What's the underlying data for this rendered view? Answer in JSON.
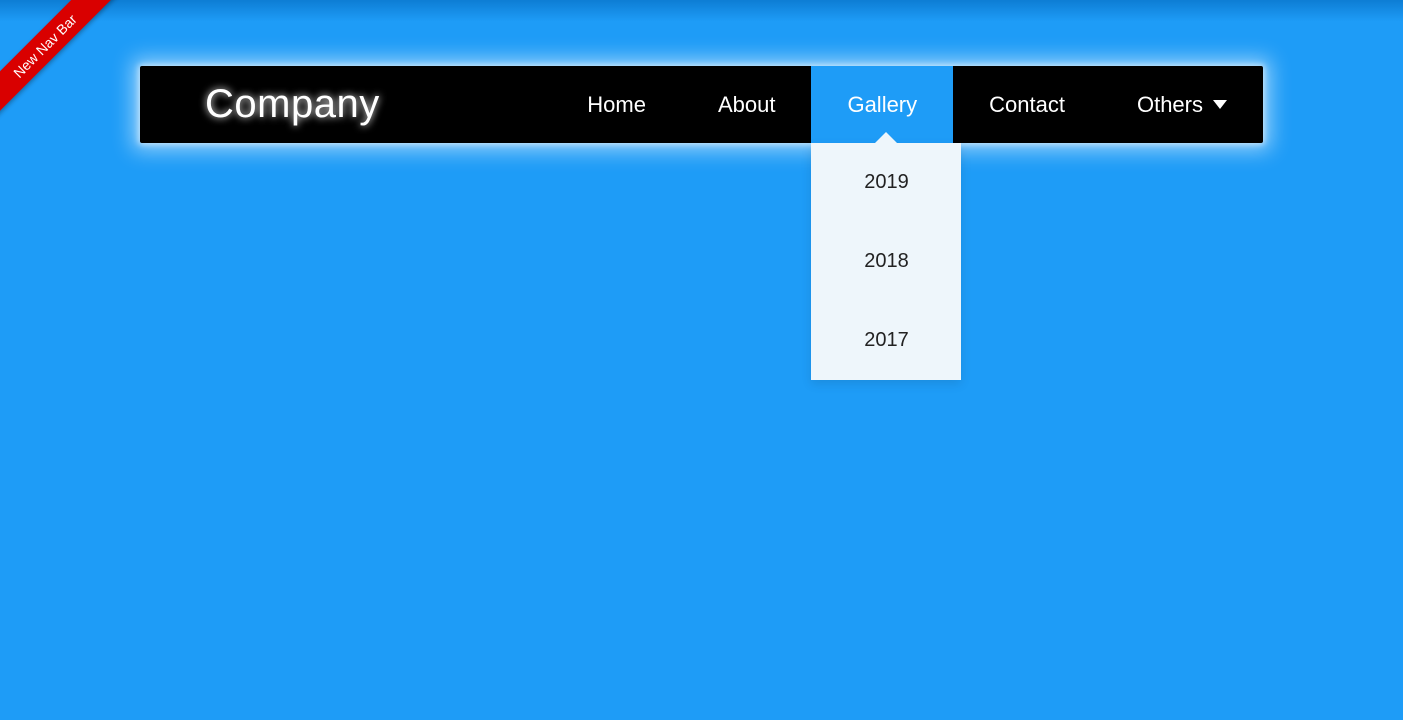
{
  "ribbon": {
    "label": "New Nav Bar"
  },
  "brand": {
    "name": "Company"
  },
  "nav": {
    "items": [
      {
        "label": "Home",
        "active": false
      },
      {
        "label": "About",
        "active": false
      },
      {
        "label": "Gallery",
        "active": true
      },
      {
        "label": "Contact",
        "active": false
      },
      {
        "label": "Others",
        "active": false,
        "has_caret": true
      }
    ]
  },
  "gallery_dropdown": {
    "items": [
      {
        "label": "2019"
      },
      {
        "label": "2018"
      },
      {
        "label": "2017"
      }
    ]
  },
  "colors": {
    "page_bg": "#1e9cf7",
    "navbar_bg": "#000000",
    "ribbon_bg": "#d90000",
    "dropdown_bg": "#eef6fb"
  }
}
